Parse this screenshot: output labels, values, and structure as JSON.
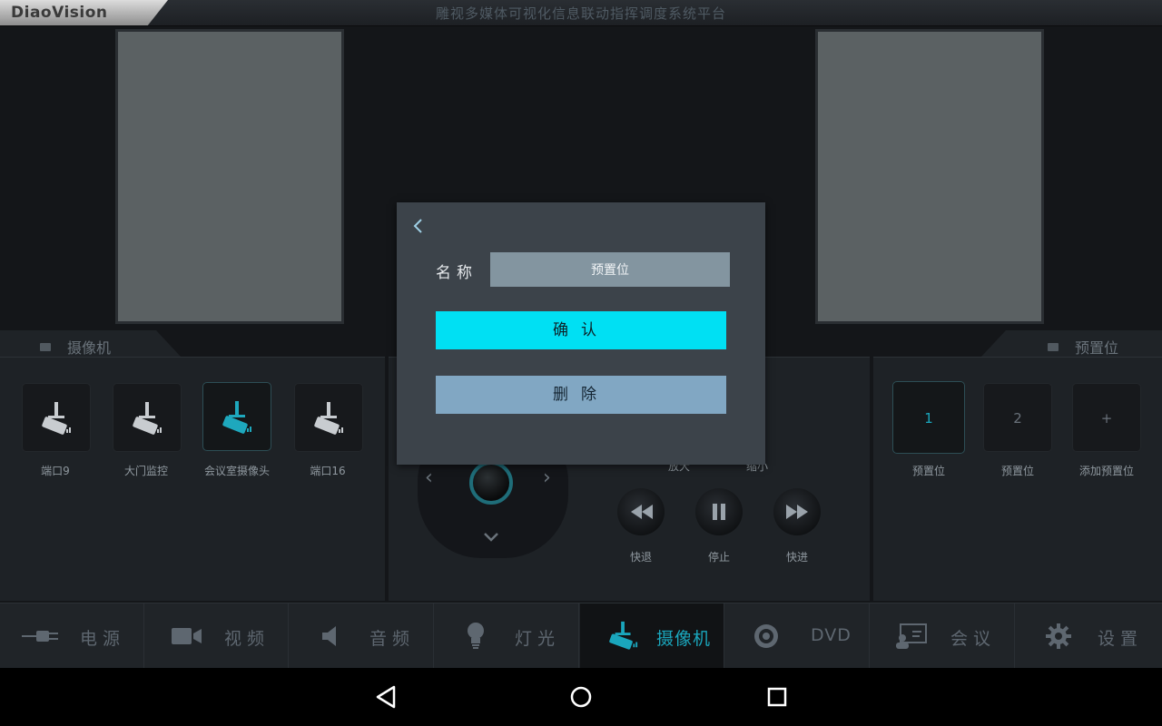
{
  "header": {
    "logo_text": "DiaoVision",
    "title": "雕视多媒体可视化信息联动指挥调度系统平台"
  },
  "camera_panel": {
    "tab_label": "摄像机",
    "cameras": [
      {
        "label": "端口9",
        "active": false
      },
      {
        "label": "大门监控",
        "active": false
      },
      {
        "label": "会议室摄像头",
        "active": true
      },
      {
        "label": "端口16",
        "active": false
      }
    ]
  },
  "preset_panel": {
    "tab_label": "预置位",
    "presets": [
      {
        "number": "1",
        "label": "预置位",
        "active": true
      },
      {
        "number": "2",
        "label": "预置位",
        "active": false
      },
      {
        "number": "+",
        "label": "添加预置位",
        "active": false
      }
    ]
  },
  "control_panel": {
    "zoom_in_label": "放大",
    "zoom_out_label": "缩小",
    "rewind_label": "快退",
    "pause_label": "停止",
    "forward_label": "快进"
  },
  "dialog": {
    "name_label": "名称",
    "name_value": "预置位",
    "confirm_label": "确认",
    "delete_label": "删除"
  },
  "nav": {
    "items": [
      {
        "label": "电源",
        "icon": "power-plug-icon"
      },
      {
        "label": "视频",
        "icon": "video-camera-icon"
      },
      {
        "label": "音频",
        "icon": "speaker-icon"
      },
      {
        "label": "灯光",
        "icon": "light-bulb-icon"
      },
      {
        "label": "摄像机",
        "icon": "surveillance-camera-icon"
      },
      {
        "label": "DVD",
        "icon": "disc-icon"
      },
      {
        "label": "会议",
        "icon": "meeting-icon"
      },
      {
        "label": "设置",
        "icon": "gear-icon"
      }
    ],
    "active_index": 4
  },
  "colors": {
    "accent": "#00e0f3",
    "active_text": "#1aa6bc",
    "dialog_bg": "#3c434a",
    "delete_bg": "#81a7c3"
  }
}
